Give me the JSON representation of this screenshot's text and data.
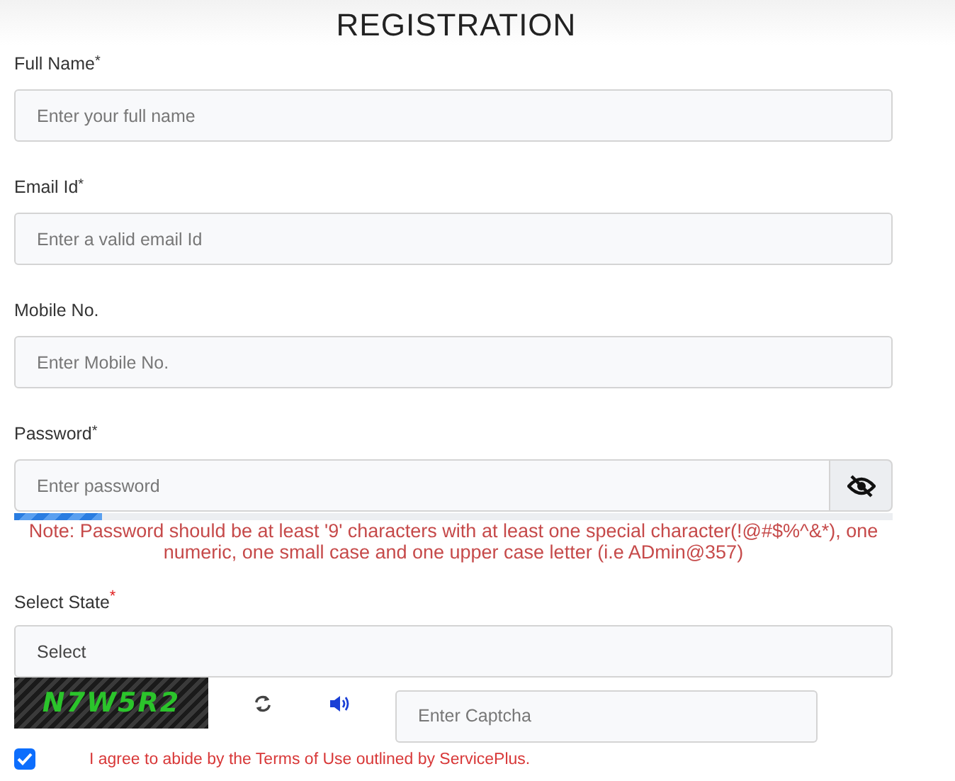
{
  "title": "REGISTRATION",
  "fields": [
    {
      "kind": "text",
      "label": "Full Name",
      "asterisk": "*",
      "raised": false,
      "placeholder": "Enter your full name"
    },
    {
      "kind": "text",
      "label": "Email Id",
      "asterisk": "*",
      "raised": false,
      "placeholder": "Enter a valid email Id"
    },
    {
      "kind": "text",
      "label": "Mobile No.",
      "placeholder": "Enter Mobile No."
    },
    {
      "kind": "password",
      "label": "Password",
      "asterisk": "*",
      "raised": false,
      "placeholder": "Enter password",
      "strength": {
        "level": 0.1
      },
      "note": "Note: Password should be at least '9' characters with at least one special character(!@#$%^&*), one numeric, one small case and one upper case letter (i.e ADmin@357)"
    },
    {
      "kind": "select",
      "label": "Select State",
      "asterisk": "*",
      "raised": true,
      "placeholder": "Select"
    }
  ],
  "captcha": {
    "code": "N7W5R2",
    "placeholder": "Enter Captcha"
  },
  "agreement": {
    "checked": true,
    "text": "I agree to abide by the Terms of Use outlined by ServicePlus."
  }
}
